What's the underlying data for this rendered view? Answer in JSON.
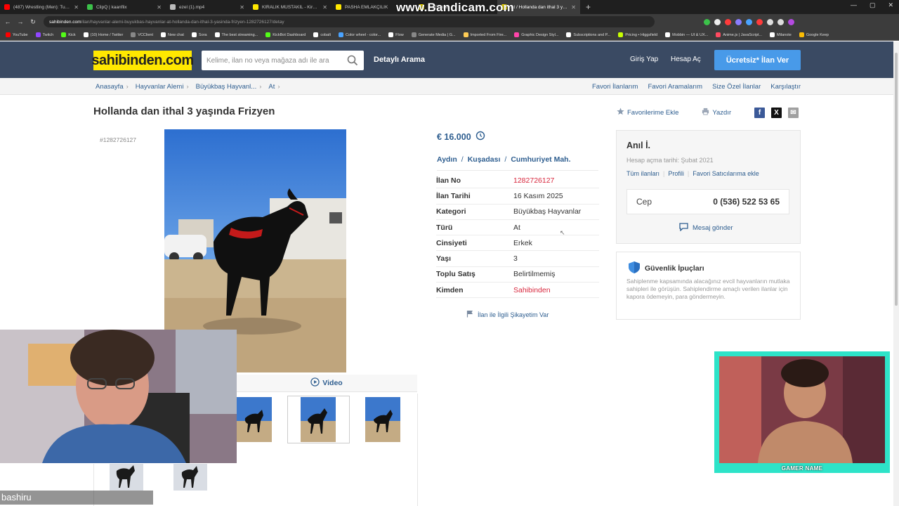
{
  "browser": {
    "tabs": [
      {
        "title": "(487) Wrestling (Men): Turkish",
        "color": "#ff0000"
      },
      {
        "title": "ClipQ | kaanflix",
        "color": "#3cc24a"
      },
      {
        "title": "ezel (1).mp4",
        "color": "#bbbbbb"
      },
      {
        "title": "KİRALIK MÜSTAKİL - Kiralık Villa",
        "color": "#ffe800"
      },
      {
        "title": "PASHA EMLAKÇILIK",
        "color": "#ffe800"
      },
      {
        "title": "(1) Ekstra",
        "color": "#ffe800"
      },
      {
        "title": "At / Hollanda dan ithal 3 yaşında",
        "color": "#ffe800"
      }
    ],
    "overlay_watermark": "www.Bandicam.com",
    "url_host": "sahibinden.com",
    "url_path": "/ilan/hayvanlar-alemi-buyukbas-hayvanlar-at-hollanda-dan-ithal-3-yasinda-frizyen-1282726127/detay",
    "bookmarks": [
      {
        "label": "YouTube",
        "color": "#ff0000"
      },
      {
        "label": "Twitch",
        "color": "#9146ff"
      },
      {
        "label": "Kick",
        "color": "#53fc18"
      },
      {
        "label": "(10) Home / Twitter",
        "color": "#ffffff"
      },
      {
        "label": "VCClient",
        "color": "#888888"
      },
      {
        "label": "New chat",
        "color": "#ffffff"
      },
      {
        "label": "Sora",
        "color": "#ffffff"
      },
      {
        "label": "The best streaming...",
        "color": "#ffffff"
      },
      {
        "label": "KickBot Dashboard",
        "color": "#53fc18"
      },
      {
        "label": "cobalt",
        "color": "#ffffff"
      },
      {
        "label": "Color wheel - color...",
        "color": "#4aa3ff"
      },
      {
        "label": "Flow",
        "color": "#ffffff"
      },
      {
        "label": "Generate Media | G...",
        "color": "#888888"
      },
      {
        "label": "Imported From Fire...",
        "color": "#ffcc55"
      },
      {
        "label": "Graphic Design Styl...",
        "color": "#ff44aa"
      },
      {
        "label": "Subscriptions and P...",
        "color": "#ffffff"
      },
      {
        "label": "Pricing • Higgsfield",
        "color": "#c8ff00"
      },
      {
        "label": "Mobbin — UI & UX...",
        "color": "#ffffff"
      },
      {
        "label": "Anime.js | JavaScript...",
        "color": "#ff4a60"
      },
      {
        "label": "Milanote",
        "color": "#ffffff"
      },
      {
        "label": "Google Keep",
        "color": "#fbbc04"
      }
    ]
  },
  "header": {
    "logo": "sahibinden.com",
    "search_placeholder": "Kelime, ilan no veya mağaza adı ile ara",
    "detailed_search": "Detaylı Arama",
    "login": "Giriş Yap",
    "register": "Hesap Aç",
    "post_ad": "Ücretsiz* İlan Ver"
  },
  "breadcrumb": {
    "items": [
      "Anasayfa",
      "Hayvanlar Alemi",
      "Büyükbaş Hayvanl...",
      "At"
    ],
    "right_links": [
      "Favori İlanlarım",
      "Favori Aramalarım",
      "Size Özel İlanlar",
      "Karşılaştır"
    ]
  },
  "listing": {
    "title": "Hollanda dan ithal 3 yaşında Frizyen",
    "actions": {
      "favorite": "Favorilerime Ekle",
      "print": "Yazdır"
    },
    "id_label": "#1282726127",
    "video_label": "Video",
    "price": "€ 16.000",
    "location": [
      "Aydın",
      "Kuşadası",
      "Cumhuriyet Mah."
    ],
    "details": [
      {
        "key": "İlan No",
        "value": "1282726127",
        "red": true
      },
      {
        "key": "İlan Tarihi",
        "value": "16 Kasım 2025",
        "red": false
      },
      {
        "key": "Kategori",
        "value": "Büyükbaş Hayvanlar",
        "red": false
      },
      {
        "key": "Türü",
        "value": "At",
        "red": false
      },
      {
        "key": "Cinsiyeti",
        "value": "Erkek",
        "red": false
      },
      {
        "key": "Yaşı",
        "value": "3",
        "red": false
      },
      {
        "key": "Toplu Satış",
        "value": "Belirtilmemiş",
        "red": false
      },
      {
        "key": "Kimden",
        "value": "Sahibinden",
        "red": true
      }
    ],
    "complaint": "İlan ile İlgili Şikayetim Var"
  },
  "seller": {
    "name": "Anıl İ.",
    "since": "Hesap açma tarihi: Şubat 2021",
    "links": [
      "Tüm ilanları",
      "Profili",
      "Favori Satıcılarıma ekle"
    ],
    "phone_label": "Cep",
    "phone": "0 (536) 522 53 65",
    "message": "Mesaj gönder"
  },
  "safety": {
    "title": "Güvenlik İpuçları",
    "body": "Sahiplenme kapsamında alacağınız evcil hayvanların mutlaka sahipleri ile görüşün. Sahiplendirme amaçlı verilen ilanlar için kapora ödemeyin, para göndermeyin."
  },
  "stream_overlay": {
    "cam2_label": "GAMER NAME",
    "streamer_name": "bashiru"
  },
  "colors": {
    "header_bg": "#3a4a63",
    "logo_bg": "#ffe800",
    "cta_blue": "#489ae9",
    "link_blue": "#2d5d8f",
    "red_value": "#d8283e"
  }
}
